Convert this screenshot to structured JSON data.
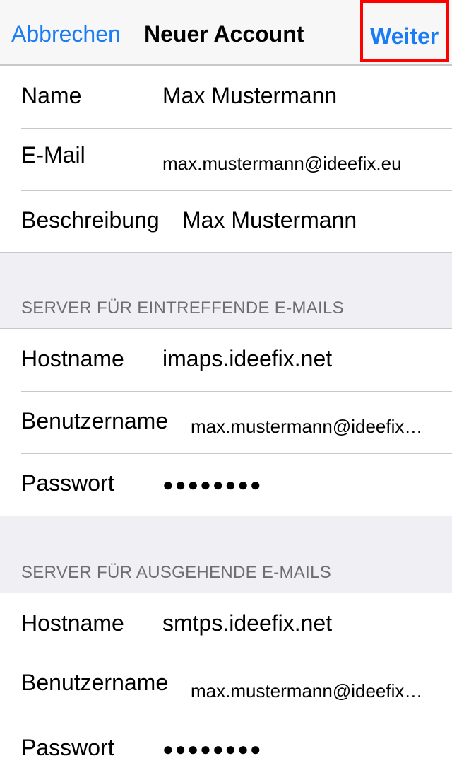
{
  "navbar": {
    "cancel_label": "Abbrechen",
    "title": "Neuer Account",
    "next_label": "Weiter"
  },
  "account": {
    "name_label": "Name",
    "name_value": "Max Mustermann",
    "email_label": "E-Mail",
    "email_value": "max.mustermann@ideefix.eu",
    "description_label": "Beschreibung",
    "description_value": "Max Mustermann"
  },
  "incoming": {
    "header": "SERVER FÜR EINTREFFENDE E-MAILS",
    "hostname_label": "Hostname",
    "hostname_value": "imaps.ideefix.net",
    "username_label": "Benutzername",
    "username_value": "max.mustermann@ideefix.eu",
    "password_label": "Passwort",
    "password_value": "●●●●●●●●"
  },
  "outgoing": {
    "header": "SERVER FÜR AUSGEHENDE E-MAILS",
    "hostname_label": "Hostname",
    "hostname_value": "smtps.ideefix.net",
    "username_label": "Benutzername",
    "username_value": "max.mustermann@ideefix.eu",
    "password_label": "Passwort",
    "password_value": "●●●●●●●●"
  },
  "colors": {
    "accent": "#1a7cf5",
    "highlight": "#ff0000",
    "background": "#efeff4"
  }
}
